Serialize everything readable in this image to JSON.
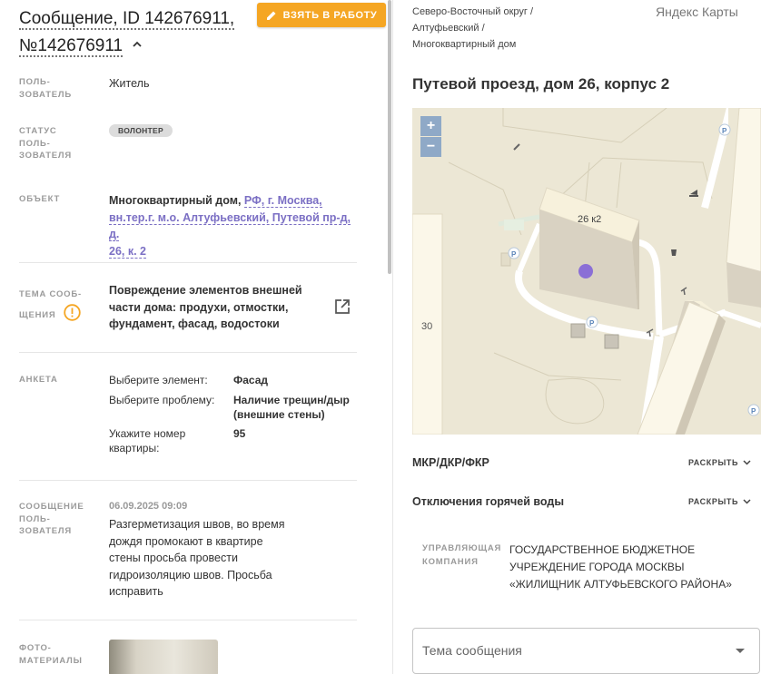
{
  "header": {
    "title_line1": "Сообщение, ID 142676911,",
    "title_line2": "№142676911",
    "take_button": "ВЗЯТЬ В РАБОТУ"
  },
  "fields": {
    "user_label_1": "ПОЛЬ-",
    "user_label_2": "ЗОВАТЕЛЬ",
    "user_value": "Житель",
    "status_label_1": "СТАТУС",
    "status_label_2": "ПОЛЬ-",
    "status_label_3": "ЗОВАТЕЛЯ",
    "status_badge": "ВОЛОНТЕР",
    "object_label": "ОБЪЕКТ",
    "object_prefix": "Многоквартирный дом,",
    "object_link_1": "РФ, г. Москва,",
    "object_link_2": "вн.тер.г. м.о. Алтуфьевский, Путевой пр-д, д.",
    "object_link_3": "26, к. 2",
    "topic_label_1": "ТЕМА СООБ-",
    "topic_label_2": "ЩЕНИЯ",
    "topic_line_1": "Повреждение элементов внешней",
    "topic_line_2": "части дома: продухи, отмостки,",
    "topic_line_3": "фундамент, фасад, водостоки",
    "anketa_label": "АНКЕТА",
    "q1": "Выберите элемент:",
    "a1": "Фасад",
    "q2": "Выберите проблему:",
    "a2_line1": "Наличие трещин/дыр",
    "a2_line2": "(внешние стены)",
    "q3_line1": "Укажите номер",
    "q3_line2": "квартиры:",
    "a3": "95",
    "msg_label_1": "СООБЩЕНИЕ",
    "msg_label_2": "ПОЛЬ-",
    "msg_label_3": "ЗОВАТЕЛЯ",
    "msg_date": "06.09.2025 09:09",
    "msg_line_1": "Разгерметизация швов, во время",
    "msg_line_2": "дождя промокают в квартире",
    "msg_line_3": "стены просьба провести",
    "msg_line_4": "гидроизоляцию швов. Просьба",
    "msg_line_5": "исправить",
    "photo_label_1": "ФОТО-",
    "photo_label_2": "МАТЕРИАЛЫ"
  },
  "right": {
    "breadcrumb_1": "Северо-Восточный округ /",
    "breadcrumb_2": "Алтуфьевский /",
    "breadcrumb_3": "Многоквартирный дом",
    "maps_brand": "Яндекс Карты",
    "address": "Путевой проезд, дом 26, корпус 2",
    "map": {
      "zoom_in": "+",
      "zoom_out": "−",
      "building_label": "26 к2",
      "side_label": "30",
      "parking": "P"
    },
    "accordion_1": "МКР/ДКР/ФКР",
    "accordion_2": "Отключения горячей воды",
    "expand_label": "РАСКРЫТЬ",
    "uk_label_1": "УПРАВЛЯЮЩАЯ",
    "uk_label_2": "КОМПАНИЯ",
    "uk_value_1": "ГОСУДАРСТВЕННОЕ БЮДЖЕТНОЕ",
    "uk_value_2": "УЧРЕЖДЕНИЕ ГОРОДА МОСКВЫ",
    "uk_value_3": "«ЖИЛИЩНИК АЛТУФЬЕВСКОГО РАЙОНА»",
    "topic_select_placeholder": "Тема сообщения"
  },
  "colors": {
    "accent_orange": "#f5a623",
    "link_purple": "#7b6fc4",
    "map_marker": "#8b6fd6",
    "zoom_button": "#8fa9c7"
  }
}
